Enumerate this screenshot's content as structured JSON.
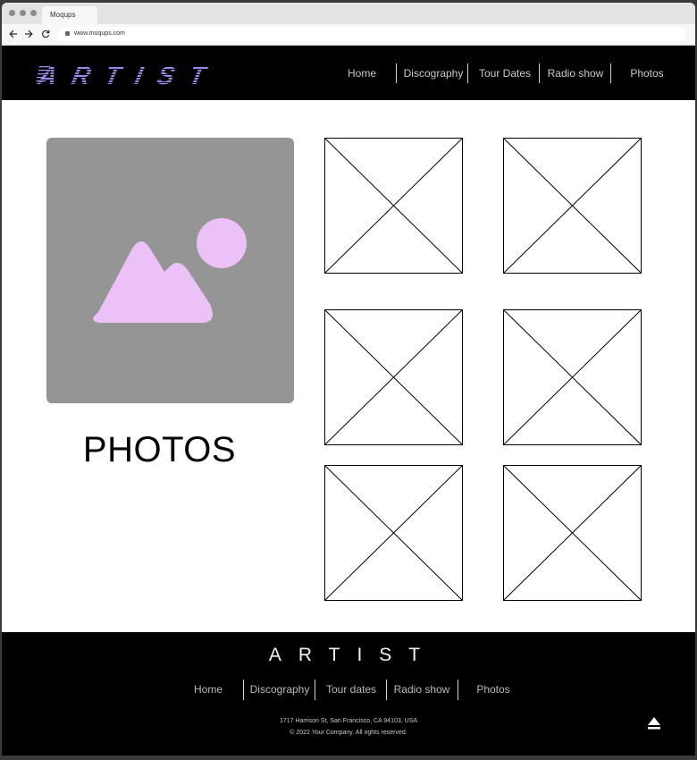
{
  "browser": {
    "tab_title": "Moqups",
    "url": "www.moqups.com",
    "nav_icons": [
      "back-arrow-icon",
      "forward-arrow-icon",
      "reload-icon",
      "lock-icon"
    ]
  },
  "header": {
    "logo": "ARTIST",
    "logo_color": "#a48ef1",
    "nav": [
      "Home",
      "Discography",
      "Tour Dates",
      "Radio show",
      "Photos"
    ]
  },
  "main": {
    "hero_image_icon": "mountain-sun-image-icon",
    "hero_bg_color": "#959595",
    "hero_icon_color": "#ebc1f7",
    "section_title": "PHOTOS",
    "placeholders": [
      "image-placeholder",
      "image-placeholder",
      "image-placeholder",
      "image-placeholder",
      "image-placeholder",
      "image-placeholder"
    ]
  },
  "footer": {
    "logo": "ARTIST",
    "nav": [
      "Home",
      "Discography",
      "Tour dates",
      "Radio show",
      "Photos"
    ],
    "address": "1717 Harrison St, San Francisco, CA 94103, USA",
    "copyright": "© 2022 Your Company.  All rights reserved.",
    "back_to_top_icon": "eject-up-icon"
  }
}
